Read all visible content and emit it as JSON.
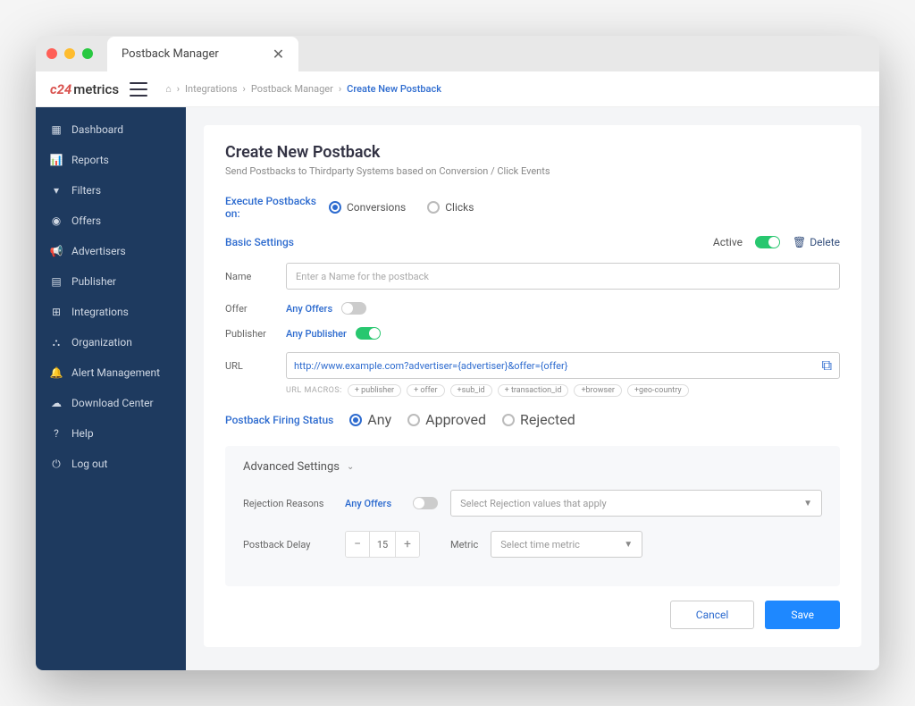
{
  "window": {
    "tab_title": "Postback Manager"
  },
  "logo": {
    "prefix": "c24",
    "suffix": "metrics"
  },
  "breadcrumb": {
    "items": [
      "Integrations",
      "Postback Manager"
    ],
    "current": "Create New Postback"
  },
  "sidebar": {
    "items": [
      {
        "label": "Dashboard",
        "icon": "dashboard-icon"
      },
      {
        "label": "Reports",
        "icon": "reports-icon"
      },
      {
        "label": "Filters",
        "icon": "filters-icon"
      },
      {
        "label": "Offers",
        "icon": "offers-icon"
      },
      {
        "label": "Advertisers",
        "icon": "advertisers-icon"
      },
      {
        "label": "Publisher",
        "icon": "publisher-icon"
      },
      {
        "label": "Integrations",
        "icon": "integrations-icon"
      },
      {
        "label": "Organization",
        "icon": "organization-icon"
      },
      {
        "label": "Alert Management",
        "icon": "alert-icon"
      },
      {
        "label": "Download Center",
        "icon": "download-icon"
      },
      {
        "label": "Help",
        "icon": "help-icon"
      },
      {
        "label": "Log  out",
        "icon": "logout-icon"
      }
    ]
  },
  "page": {
    "title": "Create New Postback",
    "subtitle": "Send Postbacks to Thirdparty Systems based on Conversion / Click Events"
  },
  "execute": {
    "label": "Execute Postbacks on:",
    "options": [
      "Conversions",
      "Clicks"
    ],
    "selected": "Conversions"
  },
  "basic": {
    "title": "Basic Settings",
    "active_label": "Active",
    "active_on": true,
    "delete_label": "Delete",
    "name_label": "Name",
    "name_placeholder": "Enter a Name for the postback",
    "offer_label": "Offer",
    "offer_value": "Any Offers",
    "offer_toggle_on": false,
    "publisher_label": "Publisher",
    "publisher_value": "Any Publisher",
    "publisher_toggle_on": true,
    "url_label": "URL",
    "url_value": "http://www.example.com?advertiser={advertiser}&offer={offer}",
    "macros_label": "URL MACROS:",
    "macros": [
      "+ publisher",
      "+ offer",
      "+sub_id",
      "+ transaction_id",
      "+browser",
      "+geo-country"
    ]
  },
  "firing": {
    "label": "Postback Firing Status",
    "options": [
      "Any",
      "Approved",
      "Rejected"
    ],
    "selected": "Any"
  },
  "advanced": {
    "title": "Advanced Settings",
    "rejection_label": "Rejection Reasons",
    "rejection_value": "Any Offers",
    "rejection_toggle_on": false,
    "rejection_placeholder": "Select Rejection values that apply",
    "delay_label": "Postback Delay",
    "delay_value": "15",
    "metric_label": "Metric",
    "metric_placeholder": "Select time metric"
  },
  "footer": {
    "cancel": "Cancel",
    "save": "Save"
  }
}
